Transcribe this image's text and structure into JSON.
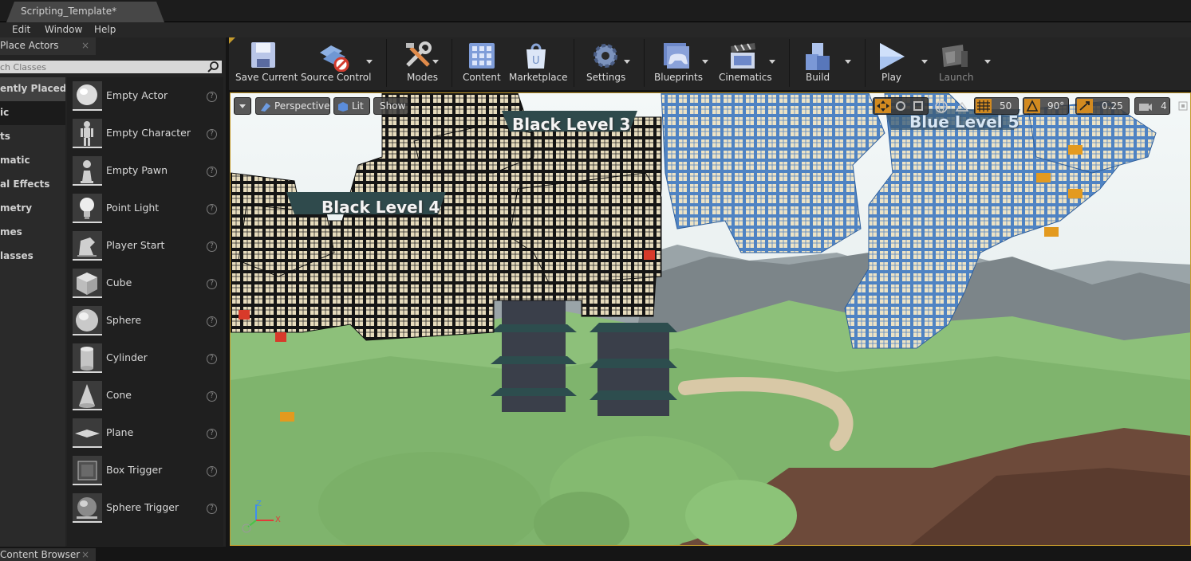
{
  "window": {
    "document_tab": "Scripting_Template*"
  },
  "menu": {
    "items": [
      "Edit",
      "Window",
      "Help"
    ]
  },
  "left_panel": {
    "tab_title": "Place Actors",
    "close_glyph": "×",
    "search_placeholder": "ch Classes",
    "categories": [
      "ently Placed",
      "ic",
      "ts",
      "matic",
      "al Effects",
      "metry",
      "mes",
      "lasses"
    ],
    "actors": [
      "Empty Actor",
      "Empty Character",
      "Empty Pawn",
      "Point Light",
      "Player Start",
      "Cube",
      "Sphere",
      "Cylinder",
      "Cone",
      "Plane",
      "Box Trigger",
      "Sphere Trigger"
    ],
    "help_glyph": "?"
  },
  "toolbar": {
    "save_current": "Save Current",
    "source_control": "Source Control",
    "modes": "Modes",
    "content": "Content",
    "marketplace": "Marketplace",
    "settings": "Settings",
    "blueprints": "Blueprints",
    "cinematics": "Cinematics",
    "build": "Build",
    "play": "Play",
    "launch": "Launch"
  },
  "viewport": {
    "view_mode": "Perspective",
    "lighting": "Lit",
    "show": "Show",
    "grid_snap": "50",
    "angle_snap": "90°",
    "scale_snap": "0.25",
    "camera_speed": "4",
    "level_labels": [
      "Black Level 3",
      "Black Level 4",
      "Blue Level 5"
    ],
    "axis_labels": {
      "x": "X",
      "z": "Z"
    }
  },
  "bottom": {
    "content_browser_tab": "Content Browser",
    "close_glyph": "×"
  },
  "colors": {
    "viewport_border": "#c49a2c",
    "sky": "#e9f0f2",
    "grass": "#8dc07a",
    "dirt": "#6d4a3a",
    "black_blocks": "#151515",
    "blue_blocks": "#4f83c3",
    "block_face": "#e7dcbd"
  }
}
